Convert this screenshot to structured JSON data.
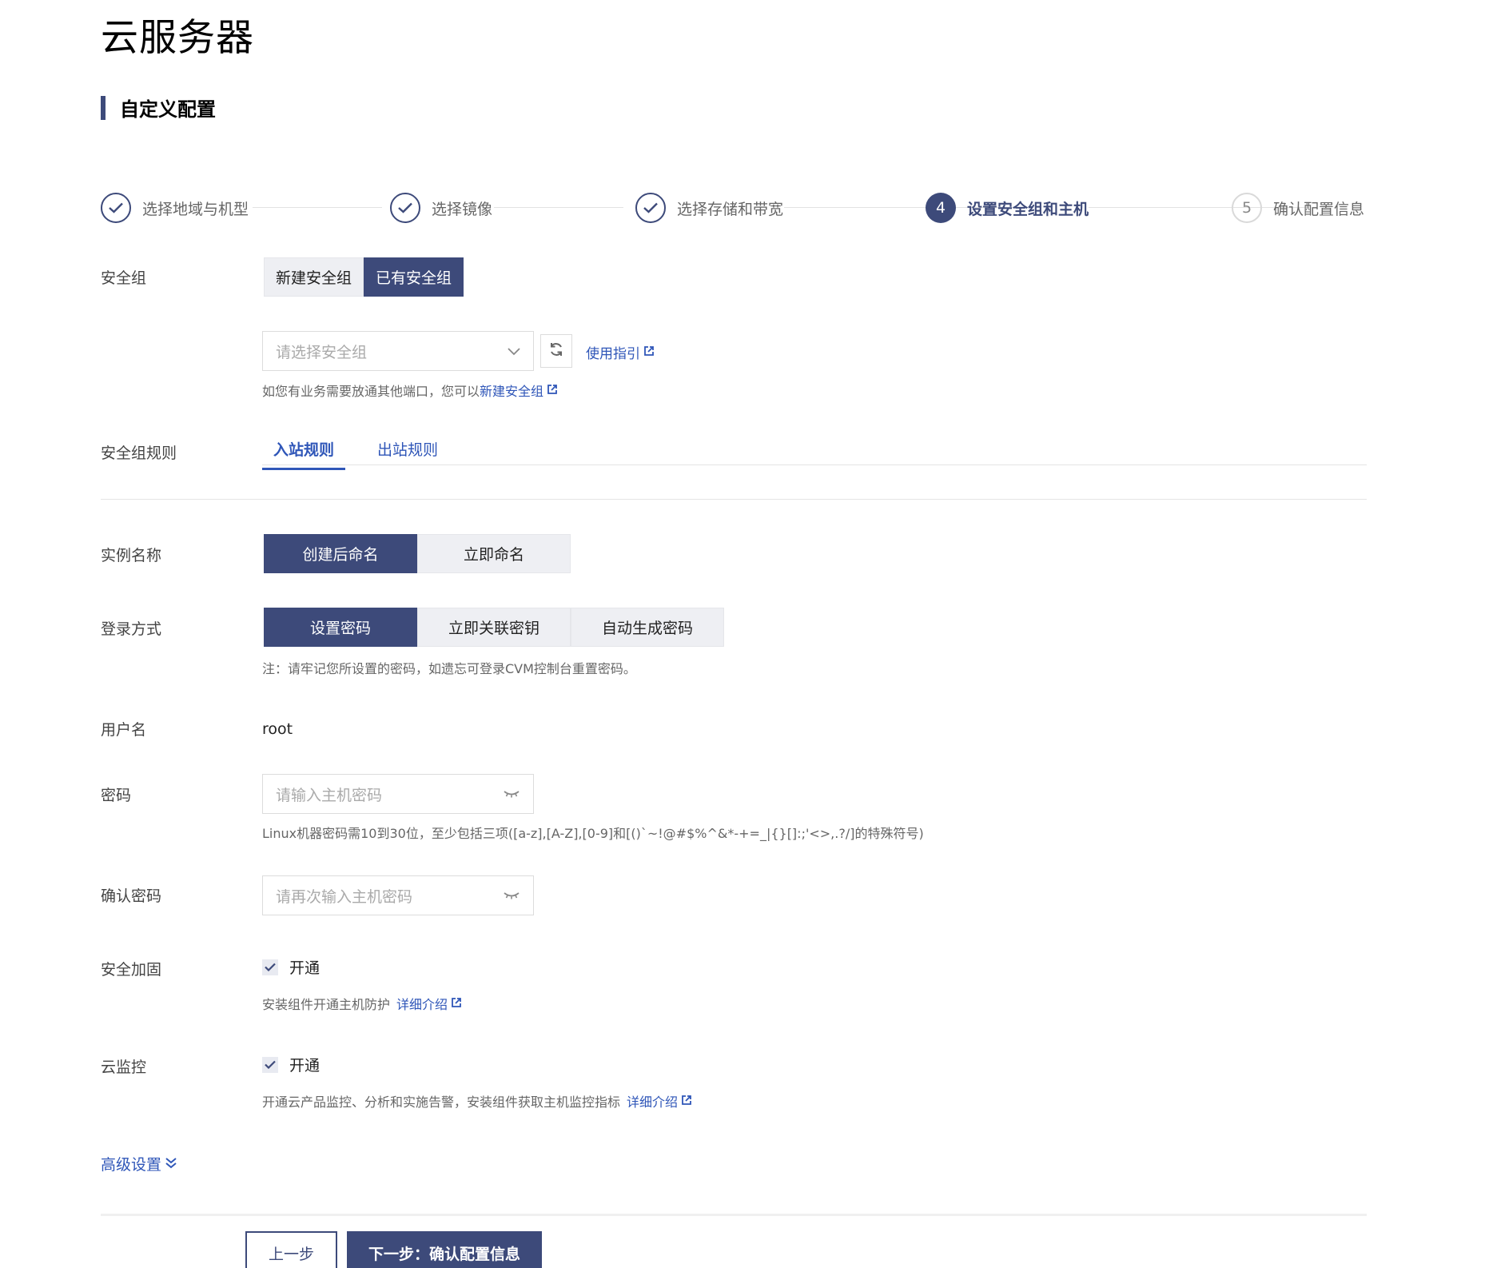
{
  "page_title": "云服务器",
  "section_title": "自定义配置",
  "steps": [
    {
      "label": "选择地域与机型",
      "state": "done"
    },
    {
      "label": "选择镜像",
      "state": "done"
    },
    {
      "label": "选择存储和带宽",
      "state": "done"
    },
    {
      "label": "设置安全组和主机",
      "number": "4",
      "state": "active"
    },
    {
      "label": "确认配置信息",
      "number": "5",
      "state": "todo"
    }
  ],
  "security_group": {
    "label": "安全组",
    "options": [
      "新建安全组",
      "已有安全组"
    ],
    "selected": "已有安全组",
    "select_placeholder": "请选择安全组",
    "guide_link": "使用指引",
    "hint_prefix": "如您有业务需要放通其他端口，您可以",
    "hint_link": "新建安全组"
  },
  "rules": {
    "label": "安全组规则",
    "tabs": [
      "入站规则",
      "出站规则"
    ],
    "active_tab": "入站规则"
  },
  "instance_name": {
    "label": "实例名称",
    "options": [
      "创建后命名",
      "立即命名"
    ],
    "selected": "创建后命名"
  },
  "login": {
    "label": "登录方式",
    "options": [
      "设置密码",
      "立即关联密钥",
      "自动生成密码"
    ],
    "selected": "设置密码",
    "note": "注：请牢记您所设置的密码，如遗忘可登录CVM控制台重置密码。"
  },
  "username": {
    "label": "用户名",
    "value": "root"
  },
  "password": {
    "label": "密码",
    "placeholder": "请输入主机密码",
    "hint": "Linux机器密码需10到30位，至少包括三项([a-z],[A-Z],[0-9]和[()`~!@#$%^&*-+=_|{}[]:;'<>,.?/]的特殊符号)"
  },
  "confirm_password": {
    "label": "确认密码",
    "placeholder": "请再次输入主机密码"
  },
  "security_hardening": {
    "label": "安全加固",
    "checkbox_label": "开通",
    "checked": true,
    "hint": "安装组件开通主机防护",
    "link": "详细介绍"
  },
  "cloud_monitor": {
    "label": "云监控",
    "checkbox_label": "开通",
    "checked": true,
    "hint": "开通云产品监控、分析和实施告警，安装组件获取主机监控指标",
    "link": "详细介绍"
  },
  "advanced": {
    "label": "高级设置"
  },
  "footer": {
    "prev": "上一步",
    "next": "下一步：确认配置信息"
  },
  "colors": {
    "primary": "#3d4a7a",
    "link": "#2f56b8"
  }
}
